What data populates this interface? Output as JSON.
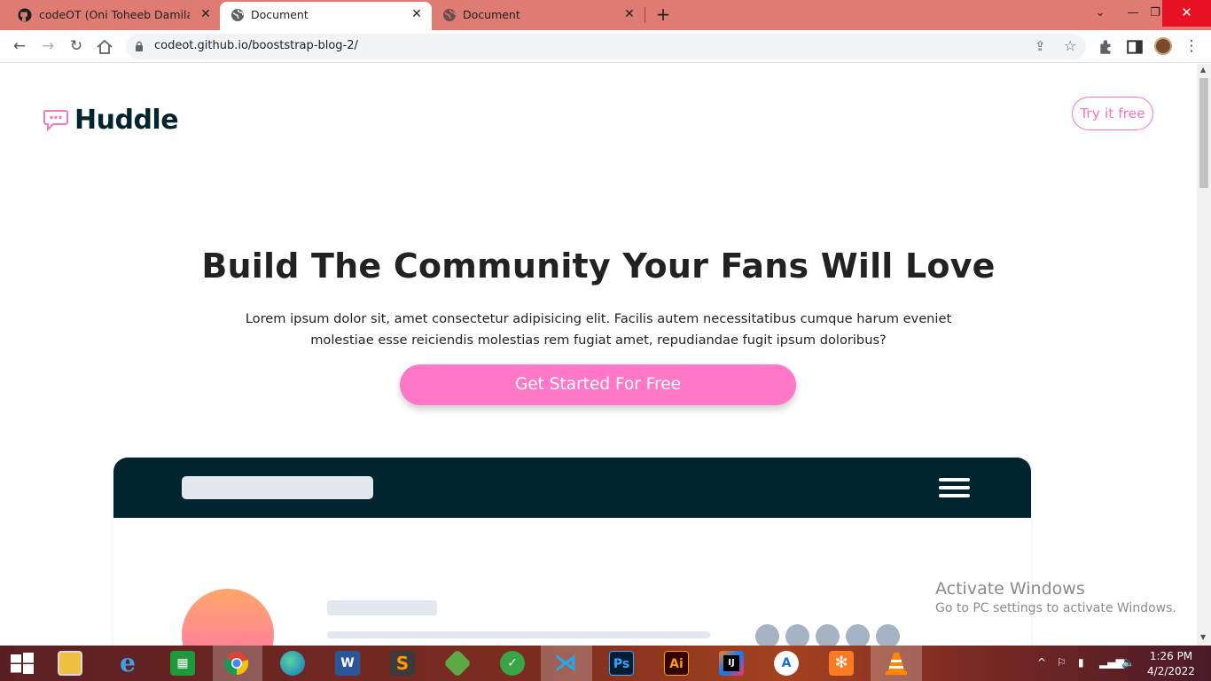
{
  "browser": {
    "tabs": [
      {
        "title": "codeOT (Oni Toheeb Damilare )",
        "icon": "github-icon"
      },
      {
        "title": "Document",
        "icon": "globe-icon",
        "active": true
      },
      {
        "title": "Document",
        "icon": "globe-icon"
      }
    ],
    "url": "codeot.github.io/booststrap-blog-2/"
  },
  "page": {
    "brand": "Huddle",
    "try_button": "Try it free",
    "hero_title": "Build The Community Your Fans Will Love",
    "hero_text": "Lorem ipsum dolor sit, amet consectetur adipisicing elit. Facilis autem necessitatibus cumque harum eveniet molestiae esse reiciendis molestias rem fugiat amet, repudiandae fugit ipsum doloribus?",
    "cta_button": "Get Started For Free",
    "colors": {
      "accent": "#fa74bf",
      "dark": "#00252e"
    }
  },
  "watermark": {
    "title": "Activate Windows",
    "subtitle": "Go to PC settings to activate Windows."
  },
  "taskbar": {
    "apps": [
      "start-icon",
      "file-explorer-icon",
      "internet-explorer-icon",
      "store-icon",
      "chrome-icon",
      "edge-icon",
      "word-icon",
      "sublime-icon",
      "node-icon",
      "app-icon",
      "vscode-icon",
      "photoshop-icon",
      "illustrator-icon",
      "intellij-icon",
      "app-icon",
      "xampp-icon",
      "vlc-icon"
    ],
    "word_label": "W",
    "ps_label": "Ps",
    "ai_label": "Ai",
    "ij_label": "IJ",
    "time": "1:26 PM",
    "date": "4/2/2022"
  }
}
